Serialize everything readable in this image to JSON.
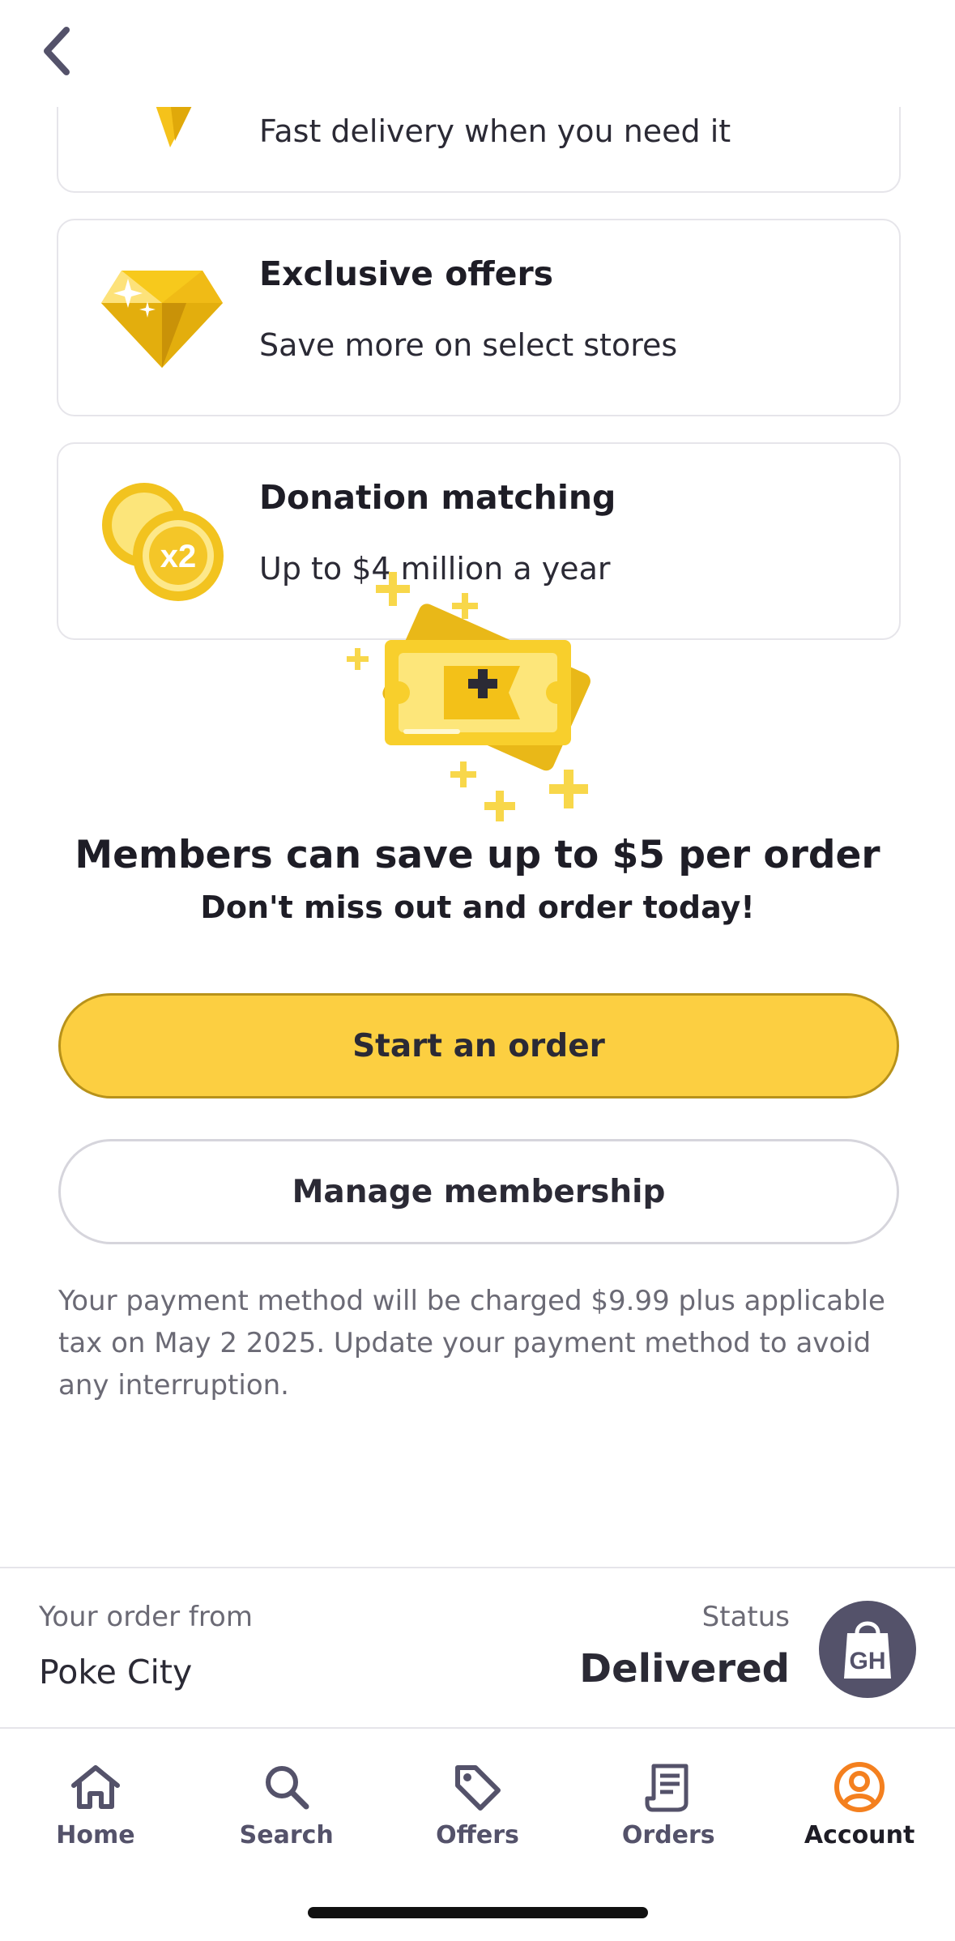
{
  "header": {
    "back_icon": "chevron-left-icon"
  },
  "perks": [
    {
      "icon": "lightning-icon",
      "title": "",
      "description": "Fast delivery when you need it"
    },
    {
      "icon": "diamond-icon",
      "title": "Exclusive offers",
      "description": "Save more on select stores"
    },
    {
      "icon": "coins-x2-icon",
      "icon_badge": "x2",
      "title": "Donation matching",
      "description": "Up to $4 million a year"
    }
  ],
  "promo": {
    "illustration": "plus-ticket-icon",
    "headline": "Members can save up to $5 per order",
    "subline": "Don't miss out and order today!",
    "primary_button": "Start an order",
    "secondary_button": "Manage membership",
    "fineprint": "Your payment method will be charged $9.99 plus applicable tax on May 2 2025. Update your payment method to avoid any interruption."
  },
  "order_banner": {
    "from_label": "Your order from",
    "from_value": "Poke City",
    "status_label": "Status",
    "status_value": "Delivered",
    "avatar_text": "GH"
  },
  "bottom_nav": {
    "items": [
      {
        "label": "Home",
        "icon": "home-icon"
      },
      {
        "label": "Search",
        "icon": "search-icon"
      },
      {
        "label": "Offers",
        "icon": "tag-icon"
      },
      {
        "label": "Orders",
        "icon": "receipt-icon"
      },
      {
        "label": "Account",
        "icon": "account-icon",
        "active": true
      }
    ]
  },
  "colors": {
    "accent_yellow": "#fccf41",
    "account_orange": "#f4801f",
    "text_dark": "#1e1d26",
    "text_muted": "#6b6a75",
    "nav_gray": "#54526a"
  }
}
